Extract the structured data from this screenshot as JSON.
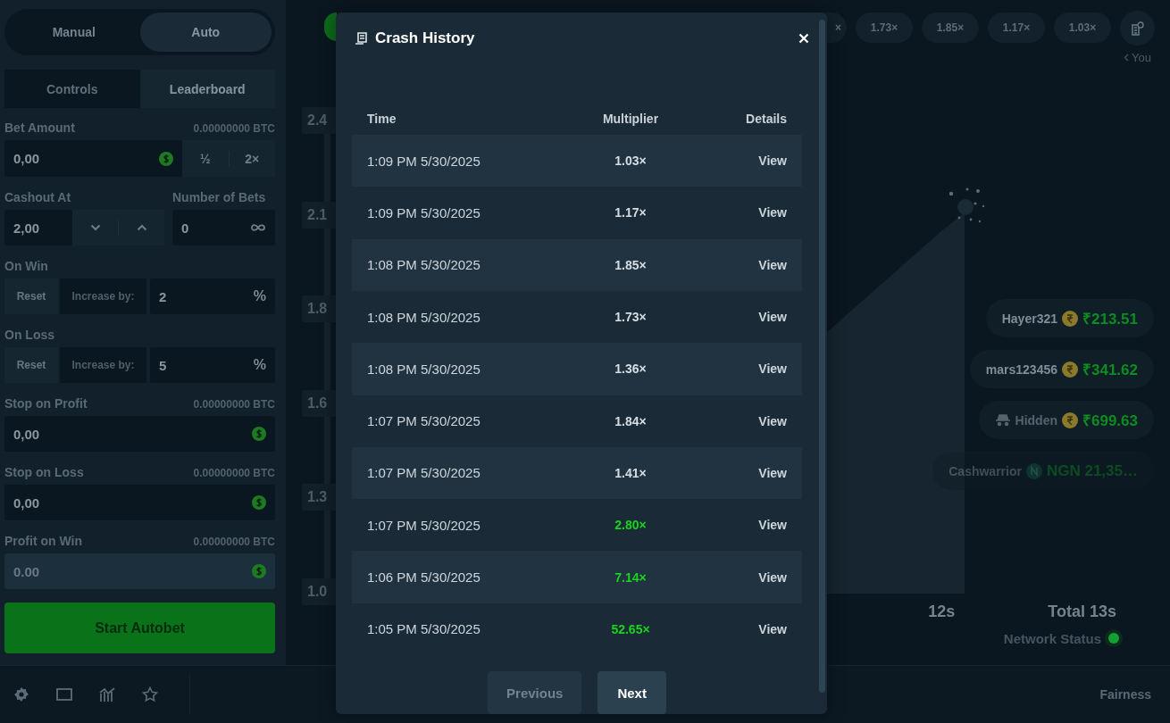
{
  "sidebar": {
    "mode_toggle": [
      {
        "label": "Manual",
        "selected": false
      },
      {
        "label": "Auto",
        "selected": true
      }
    ],
    "tabs": [
      {
        "label": "Controls",
        "selected": true
      },
      {
        "label": "Leaderboard",
        "selected": false
      }
    ],
    "bet_amount": {
      "label": "Bet Amount",
      "btc": "0.00000000 BTC",
      "value": "0,00",
      "half": "½",
      "double": "2×"
    },
    "cashout": {
      "label": "Cashout At",
      "value": "2,00"
    },
    "number_of_bets": {
      "label": "Number of Bets",
      "value": "0"
    },
    "adjustments": [
      {
        "label": "On Win",
        "reset": "Reset",
        "increase": "Increase by:",
        "value": "2",
        "unit": "%"
      },
      {
        "label": "On Loss",
        "reset": "Reset",
        "increase": "Increase by:",
        "value": "5",
        "unit": "%"
      }
    ],
    "amount_fields": [
      {
        "label": "Stop on Profit",
        "btc": "0.00000000 BTC",
        "value": "0,00",
        "disabled": false
      },
      {
        "label": "Stop on Loss",
        "btc": "0.00000000 BTC",
        "value": "0,00",
        "disabled": false
      },
      {
        "label": "Profit on Win",
        "btc": "0.00000000 BTC",
        "value": "0.00",
        "disabled": true
      }
    ],
    "start_button": "Start Autobet"
  },
  "history_pills": [
    "×",
    "1.73×",
    "1.85×",
    "1.17×",
    "1.03×"
  ],
  "you_label": "You",
  "axis_labels": [
    "2.4",
    "2.1",
    "1.8",
    "1.6",
    "1.3",
    "1.0"
  ],
  "players": [
    {
      "name": "Hayer321",
      "hidden": false,
      "kind": "rupee",
      "amount": "₹213.51",
      "faded": false
    },
    {
      "name": "mars123456",
      "hidden": false,
      "kind": "rupee",
      "amount": "₹341.62",
      "faded": false
    },
    {
      "name": "Hidden",
      "hidden": true,
      "kind": "rupee",
      "amount": "₹699.63",
      "faded": false
    },
    {
      "name": "Cashwarrior",
      "hidden": false,
      "kind": "naira",
      "amount": "NGN 21,35…",
      "faded": true
    }
  ],
  "timing": {
    "elapsed": "12s",
    "total": "Total 13s"
  },
  "network": {
    "label": "Network Status",
    "online": true
  },
  "footer": {
    "fairness": "Fairness"
  },
  "modal": {
    "title": "Crash History",
    "columns": [
      "Time",
      "Multiplier",
      "Details"
    ],
    "rows": [
      {
        "time": "1:09 PM 5/30/2025",
        "multiplier": "1.03×",
        "win": false,
        "details": "View"
      },
      {
        "time": "1:09 PM 5/30/2025",
        "multiplier": "1.17×",
        "win": false,
        "details": "View"
      },
      {
        "time": "1:08 PM 5/30/2025",
        "multiplier": "1.85×",
        "win": false,
        "details": "View"
      },
      {
        "time": "1:08 PM 5/30/2025",
        "multiplier": "1.73×",
        "win": false,
        "details": "View"
      },
      {
        "time": "1:08 PM 5/30/2025",
        "multiplier": "1.36×",
        "win": false,
        "details": "View"
      },
      {
        "time": "1:07 PM 5/30/2025",
        "multiplier": "1.84×",
        "win": false,
        "details": "View"
      },
      {
        "time": "1:07 PM 5/30/2025",
        "multiplier": "1.41×",
        "win": false,
        "details": "View"
      },
      {
        "time": "1:07 PM 5/30/2025",
        "multiplier": "2.80×",
        "win": true,
        "details": "View"
      },
      {
        "time": "1:06 PM 5/30/2025",
        "multiplier": "7.14×",
        "win": true,
        "details": "View"
      },
      {
        "time": "1:05 PM 5/30/2025",
        "multiplier": "52.65×",
        "win": true,
        "details": "View"
      }
    ],
    "pagination": [
      {
        "label": "Previous",
        "disabled": true
      },
      {
        "label": "Next",
        "disabled": false
      }
    ]
  }
}
